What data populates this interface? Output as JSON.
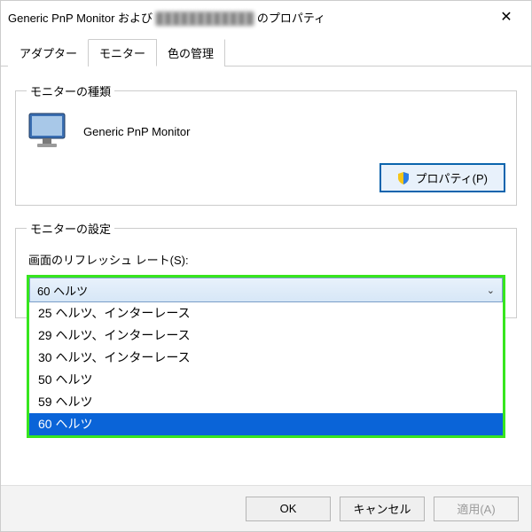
{
  "title_prefix": "Generic PnP Monitor および",
  "title_blurred": "████████████",
  "title_suffix": "のプロパティ",
  "tabs": {
    "adapter": "アダプター",
    "monitor": "モニター",
    "color": "色の管理"
  },
  "monitor_type_legend": "モニターの種類",
  "monitor_name": "Generic PnP Monitor",
  "properties_btn": "プロパティ(P)",
  "monitor_settings_legend": "モニターの設定",
  "refresh_label": "画面のリフレッシュ レート(S):",
  "selected_rate": "60 ヘルツ",
  "rates": [
    "25 ヘルツ、インターレース",
    "29 ヘルツ、インターレース",
    "30 ヘルツ、インターレース",
    "50 ヘルツ",
    "59 ヘルツ",
    "60 ヘルツ"
  ],
  "footer": {
    "ok": "OK",
    "cancel": "キャンセル",
    "apply": "適用(A)"
  }
}
